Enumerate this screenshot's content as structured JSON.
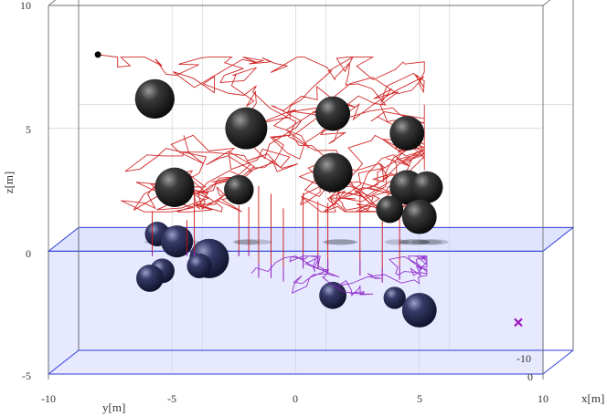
{
  "chart_data": {
    "type": "scatter",
    "title": "",
    "xlabel": "x[m]",
    "ylabel": "y[m]",
    "zlabel": "z[m]",
    "x_ticks": [
      "-10",
      "-5",
      "0",
      "5",
      "10"
    ],
    "y_ticks": [
      "-10",
      "0"
    ],
    "z_ticks": [
      "-5",
      "0",
      "5",
      "10"
    ],
    "xlim": [
      -10,
      10
    ],
    "zlim": [
      -5,
      10
    ],
    "grid": true,
    "water_surface_z": 0,
    "colors": {
      "air_path": "#cc1111",
      "water_path": "#8a1fc8",
      "sphere_above": "#2a2a2a",
      "sphere_below": "#25284a",
      "water_fill": "#c9ceff",
      "water_edge": "#2f3fd8",
      "start_marker": "#000000",
      "end_marker": "#9a1bbf"
    },
    "spheres_above_water": [
      {
        "x": -5.7,
        "z": 6.2,
        "r": 0.8
      },
      {
        "x": -2.0,
        "z": 5.0,
        "r": 0.85
      },
      {
        "x": 1.5,
        "z": 5.6,
        "r": 0.7
      },
      {
        "x": 4.5,
        "z": 4.8,
        "r": 0.7
      },
      {
        "x": -4.9,
        "z": 2.6,
        "r": 0.8
      },
      {
        "x": -2.3,
        "z": 2.5,
        "r": 0.6
      },
      {
        "x": 1.5,
        "z": 3.2,
        "r": 0.8
      },
      {
        "x": 4.5,
        "z": 2.6,
        "r": 0.7
      },
      {
        "x": 5.3,
        "z": 2.6,
        "r": 0.65
      },
      {
        "x": 3.8,
        "z": 1.7,
        "r": 0.55
      },
      {
        "x": 5.0,
        "z": 1.4,
        "r": 0.7
      }
    ],
    "spheres_below_water": [
      {
        "x": -5.6,
        "z": 0.7,
        "r": 0.5
      },
      {
        "x": -4.8,
        "z": 0.4,
        "r": 0.65
      },
      {
        "x": -3.5,
        "z": -0.3,
        "r": 0.8
      },
      {
        "x": -3.9,
        "z": -0.6,
        "r": 0.5
      },
      {
        "x": -5.4,
        "z": -0.8,
        "r": 0.5
      },
      {
        "x": -5.9,
        "z": -1.1,
        "r": 0.55
      },
      {
        "x": 1.5,
        "z": -1.8,
        "r": 0.55
      },
      {
        "x": 4.0,
        "z": -1.9,
        "r": 0.45
      },
      {
        "x": 5.0,
        "z": -2.4,
        "r": 0.7
      }
    ],
    "start_point": {
      "x": -8.0,
      "z": 8.0
    },
    "end_point": {
      "x": 9.0,
      "z": -2.9
    }
  }
}
